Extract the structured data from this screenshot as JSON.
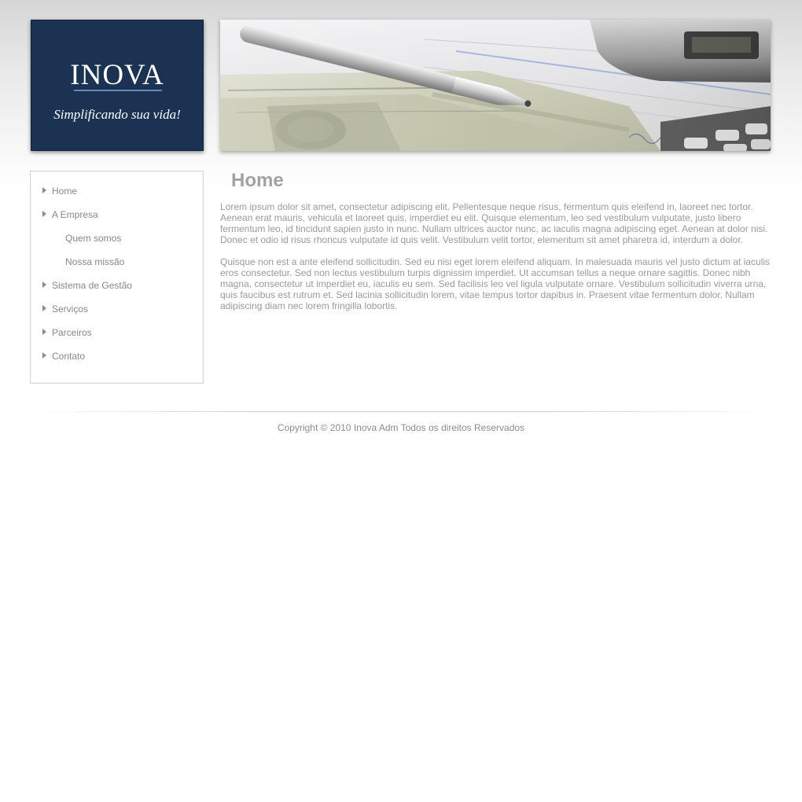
{
  "header": {
    "logo_title": "INOVA",
    "logo_slogan": "Simplificando sua vida!",
    "brand_color": "#1b3253"
  },
  "sidebar": {
    "items": [
      {
        "label": "Home",
        "level": 1
      },
      {
        "label": "A Empresa",
        "level": 1
      },
      {
        "label": "Quem somos",
        "level": 2
      },
      {
        "label": "Nossa missão",
        "level": 2
      },
      {
        "label": "Sistema de Gestão",
        "level": 1
      },
      {
        "label": "Serviços",
        "level": 1
      },
      {
        "label": "Parceiros",
        "level": 1
      },
      {
        "label": "Contato",
        "level": 1
      }
    ]
  },
  "main": {
    "title": "Home",
    "paragraphs": [
      "Lorem ipsum dolor sit amet, consectetur adipiscing elit. Pellentesque neque risus, fermentum quis eleifend in, laoreet nec tortor. Aenean erat mauris, vehicula et laoreet quis, imperdiet eu elit. Quisque elementum, leo sed vestibulum vulputate, justo libero fermentum leo, id tincidunt sapien justo in nunc. Nullam ultrices auctor nunc, ac iaculis magna adipiscing eget. Aenean at dolor nisi. Donec et odio id risus rhoncus vulputate id quis velit. Vestibulum velit tortor, elementum sit amet pharetra id, interdum a dolor.",
      "Quisque non est a ante eleifend sollicitudin. Sed eu nisi eget lorem eleifend aliquam. In malesuada mauris vel justo dictum at iaculis eros consectetur. Sed non lectus vestibulum turpis dignissim imperdiet. Ut accumsan tellus a neque ornare sagittis. Donec nibh magna, consectetur ut imperdiet eu, iaculis eu sem. Sed facilisis leo vel ligula vulputate ornare. Vestibulum sollicitudin viverra urna, quis faucibus est rutrum et. Sed lacinia sollicitudin lorem, vitae tempus tortor dapibus in. Praesent vitae fermentum dolor. Nullam adipiscing diam nec lorem fringilla lobortis."
    ]
  },
  "footer": {
    "copyright": "Copyright © 2010 Inova Adm Todos os direitos Reservados"
  }
}
